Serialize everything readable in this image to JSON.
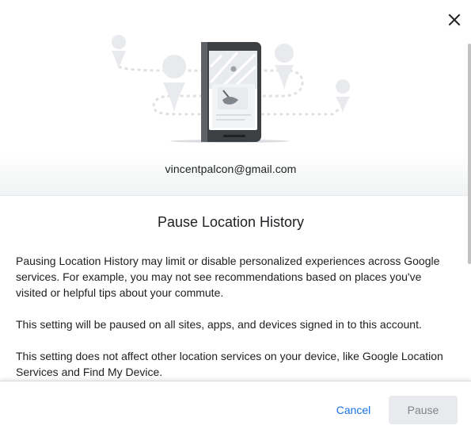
{
  "account": {
    "email": "vincentpalcon@gmail.com"
  },
  "dialog": {
    "title": "Pause Location History",
    "paragraphs": [
      "Pausing Location History may limit or disable personalized experiences across Google services. For example, you may not see recommendations based on places you've visited or helpful tips about your commute.",
      "This setting will be paused on all sites, apps, and devices signed in to this account.",
      "This setting does not affect other location services on your device, like Google Location Services and Find My Device."
    ]
  },
  "icons": {
    "close": "close-icon",
    "illustration": "phone-map-illustration"
  },
  "actions": {
    "cancel_label": "Cancel",
    "pause_label": "Pause"
  },
  "colors": {
    "accent": "#1a73e8",
    "disabled_bg": "#e8eaed",
    "disabled_text": "#80868b"
  }
}
